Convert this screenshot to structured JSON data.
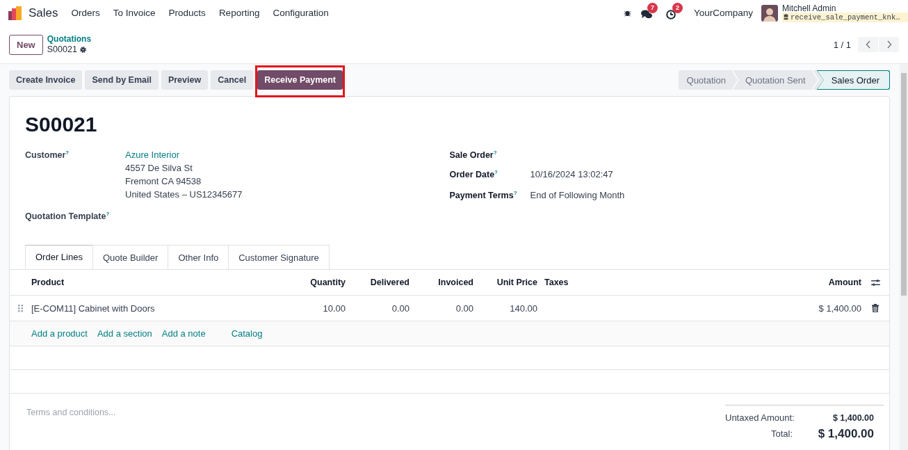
{
  "nav": {
    "app": "Sales",
    "menu": [
      "Orders",
      "To Invoice",
      "Products",
      "Reporting",
      "Configuration"
    ]
  },
  "systray": {
    "messages_count": "7",
    "activities_count": "2",
    "company": "YourCompany",
    "user": "Mitchell Admin",
    "database": "receive_sale_payment_knk…"
  },
  "breadcrumb": {
    "new_button": "New",
    "parent": "Quotations",
    "current": "S00021"
  },
  "pager": {
    "value": "1 / 1"
  },
  "actions": [
    {
      "label": "Create Invoice",
      "primary": false,
      "highlighted": false
    },
    {
      "label": "Send by Email",
      "primary": false,
      "highlighted": false
    },
    {
      "label": "Preview",
      "primary": false,
      "highlighted": false
    },
    {
      "label": "Cancel",
      "primary": false,
      "highlighted": false
    },
    {
      "label": "Receive Payment",
      "primary": true,
      "highlighted": true
    }
  ],
  "statusbar": [
    {
      "label": "Quotation",
      "selected": false
    },
    {
      "label": "Quotation Sent",
      "selected": false
    },
    {
      "label": "Sales Order",
      "selected": true
    }
  ],
  "form": {
    "title": "S00021",
    "left_fields": [
      {
        "label": "Customer",
        "help": "?",
        "kind": "link",
        "value": "Azure Interior",
        "lines": [
          "4557 De Silva St",
          "Fremont CA 94538",
          "United States – US12345677"
        ]
      },
      {
        "label": "Quotation Template",
        "help": "?",
        "kind": "empty"
      }
    ],
    "right_fields": [
      {
        "label": "Sale Order",
        "help": "?",
        "kind": "empty"
      },
      {
        "label": "Order Date",
        "help": "?",
        "kind": "text",
        "value": "10/16/2024 13:02:47"
      },
      {
        "label": "Payment Terms",
        "help": "?",
        "kind": "text",
        "value": "End of Following Month"
      }
    ]
  },
  "tabs": [
    {
      "label": "Order Lines",
      "selected": true
    },
    {
      "label": "Quote Builder",
      "selected": false
    },
    {
      "label": "Other Info",
      "selected": false
    },
    {
      "label": "Customer Signature",
      "selected": false
    }
  ],
  "table": {
    "columns": [
      "Product",
      "Quantity",
      "Delivered",
      "Invoiced",
      "Unit Price",
      "Taxes",
      "Amount"
    ],
    "rows": [
      {
        "product": "[E-COM11] Cabinet with Doors",
        "quantity": "10.00",
        "delivered": "0.00",
        "invoiced": "0.00",
        "unit_price": "140.00",
        "amount": "$ 1,400.00"
      }
    ],
    "add_links": [
      "Add a product",
      "Add a section",
      "Add a note",
      "Catalog"
    ]
  },
  "terms": {
    "placeholder": "Terms and conditions..."
  },
  "totals": {
    "untaxed_label": "Untaxed Amount:",
    "untaxed_value": "$ 1,400.00",
    "total_label": "Total:",
    "total_value": "$ 1,400.00"
  }
}
